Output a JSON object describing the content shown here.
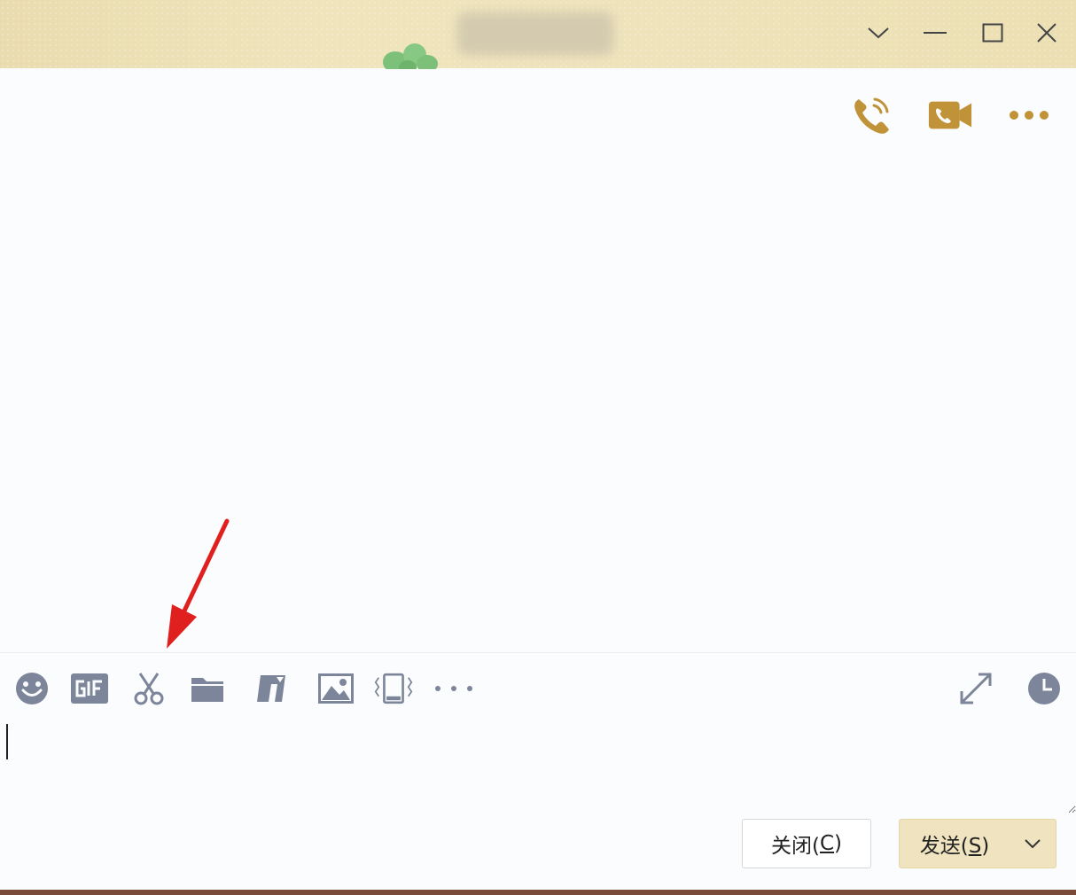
{
  "window": {
    "title_icons": {
      "dropdown": "chevron-down-icon",
      "minimize": "minimize-icon",
      "maximize": "maximize-icon",
      "close": "close-icon"
    }
  },
  "header": {
    "actions": [
      "voice-call-icon",
      "video-call-icon",
      "more-icon"
    ],
    "accent_color": "#c09338"
  },
  "toolbar": {
    "tools": [
      "emoji-icon",
      "gif-icon",
      "screenshot-scissors-icon",
      "folder-icon",
      "transfer-icon",
      "image-icon",
      "shake-icon",
      "more-icon"
    ],
    "right_tools": [
      "expand-icon",
      "history-clock-icon"
    ],
    "icon_color": "#7c8599"
  },
  "input": {
    "value": ""
  },
  "buttons": {
    "close_label": "关闭(",
    "close_key": "C",
    "close_end": ")",
    "send_label": "发送(",
    "send_key": "S",
    "send_end": ")"
  },
  "annotation": {
    "color": "#e0201e"
  }
}
